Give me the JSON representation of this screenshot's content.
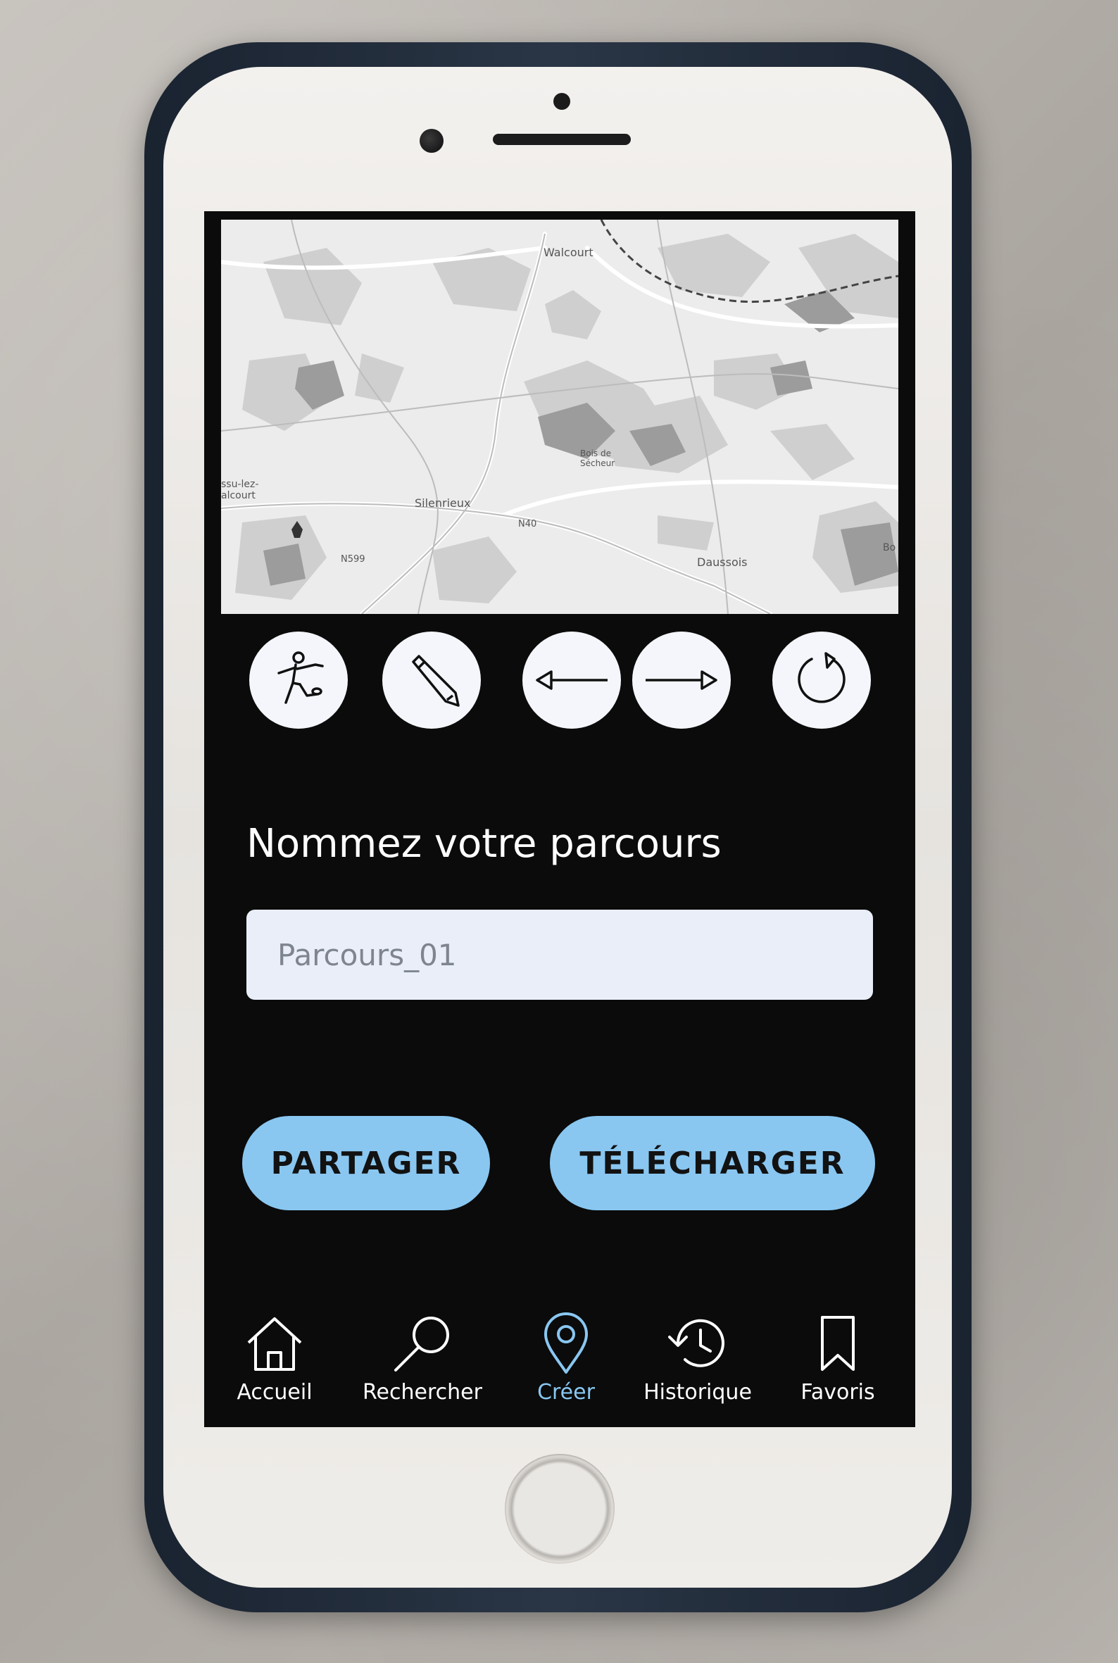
{
  "colors": {
    "screen_background": "#0b0b0b",
    "button_fill": "#89c7f1",
    "input_fill": "#e9eef8",
    "tool_fill": "#f4f6fb",
    "active_tab": "#89c7f1"
  },
  "map": {
    "labels": {
      "walcourt": "Walcourt",
      "silenrieux": "Silenrieux",
      "n40": "N40",
      "n599": "N599",
      "daussois": "Daussois",
      "bois_de_1": "Bois de",
      "bois_de_2": "Sécheur",
      "left_1": "ssu-lez-",
      "left_2": "alcourt",
      "right_1": "Bo"
    }
  },
  "toolbar": {
    "tools": [
      {
        "icon": "hiker-icon"
      },
      {
        "icon": "pencil-icon"
      },
      {
        "icon": "arrow-left-icon"
      },
      {
        "icon": "arrow-right-icon"
      },
      {
        "icon": "refresh-icon"
      }
    ]
  },
  "form": {
    "title": "Nommez votre parcours",
    "name_placeholder": "Parcours_01"
  },
  "actions": {
    "share_label": "PARTAGER",
    "download_label": "TÉLÉCHARGER"
  },
  "tabbar": {
    "active_index": 2,
    "items": [
      {
        "label": "Accueil",
        "icon": "home-icon"
      },
      {
        "label": "Rechercher",
        "icon": "search-icon"
      },
      {
        "label": "Créer",
        "icon": "map-pin-icon"
      },
      {
        "label": "Historique",
        "icon": "history-icon"
      },
      {
        "label": "Favoris",
        "icon": "bookmark-icon"
      }
    ]
  }
}
